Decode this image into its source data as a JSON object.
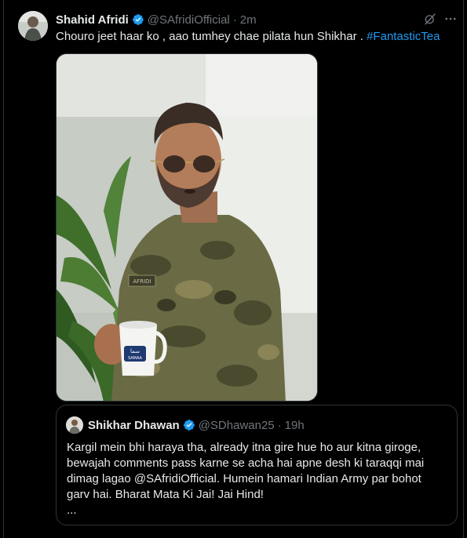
{
  "tweet": {
    "author_name": "Shahid Afridi",
    "author_handle": "@SAfridiOfficial",
    "separator": "·",
    "time": "2m",
    "text": "Chouro jeet haar ko , aao tumhey chae pilata hun Shikhar . ",
    "hashtag": "#FantasticTea",
    "media": {
      "mug_brand": "SAMAA",
      "mug_logo": "سما",
      "shirt_tag": "AFRIDI"
    }
  },
  "quote": {
    "author_name": "Shikhar Dhawan",
    "author_handle": "@SDhawan25",
    "separator": "·",
    "time": "19h",
    "lines": [
      "Kargil mein bhi haraya tha, already itna gire hue ho aur kitna giroge,",
      "bewajah comments pass karne se acha hai apne desh ki taraqqi mai",
      "dimag lagao @SAfridiOfficial. Humein hamari Indian Army par bohot",
      "garv hai. Bharat Mata Ki Jai! Jai Hind!",
      "..."
    ]
  },
  "icons": {
    "verified": "verified-badge-icon",
    "grok": "grok-icon",
    "more": "more-options-icon"
  },
  "colors": {
    "background": "#000000",
    "text": "#e7e9ea",
    "secondary_text": "#71767b",
    "link": "#1d9bf0",
    "border": "#2f3336",
    "verified_badge": "#1d9bf0"
  }
}
